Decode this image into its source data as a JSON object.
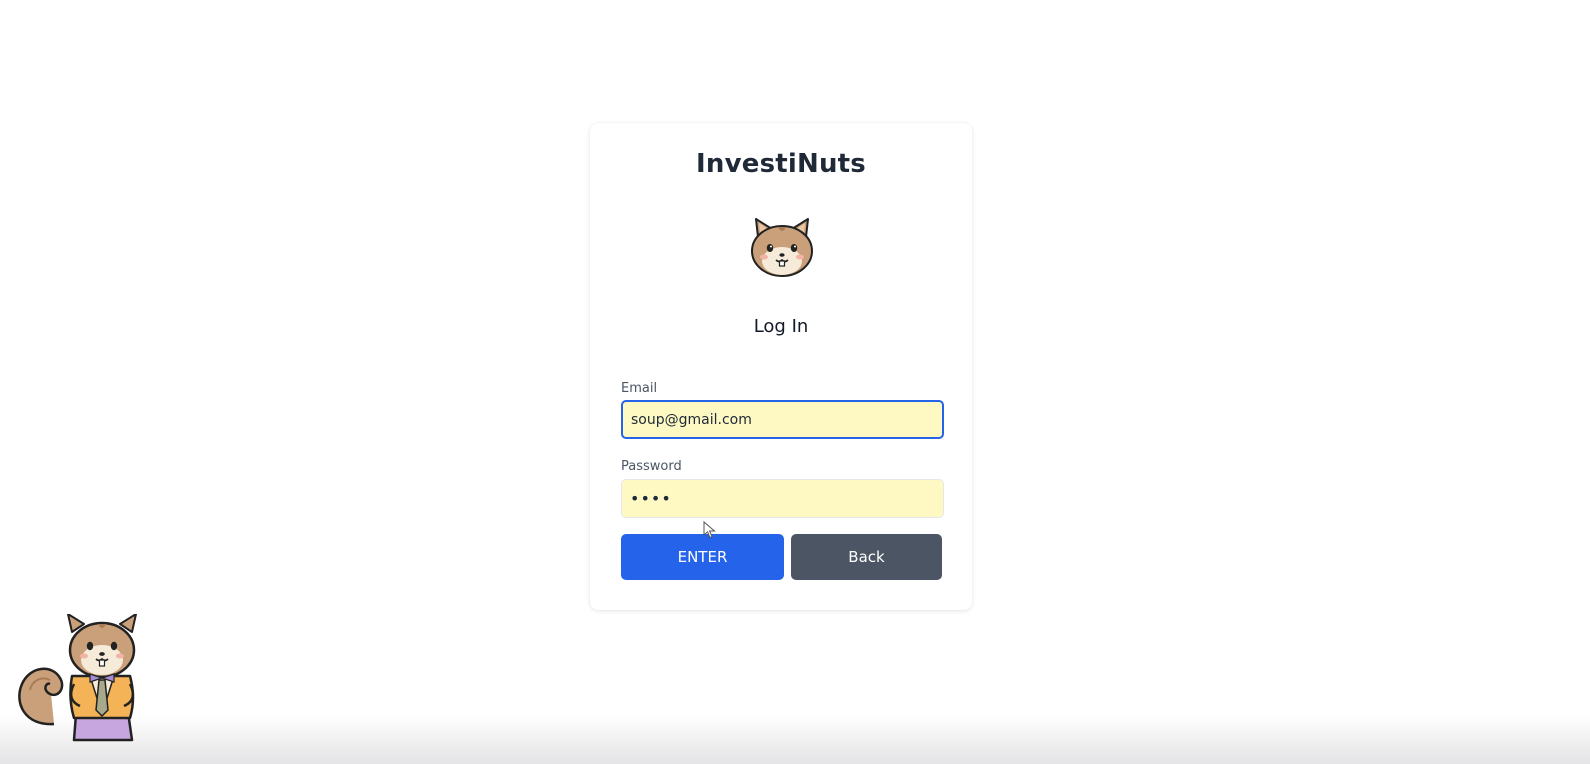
{
  "app": {
    "title": "InvestiNuts"
  },
  "login": {
    "heading": "Log In",
    "email_label": "Email",
    "email_value": "soup@gmail.com",
    "password_label": "Password",
    "password_value": "••••",
    "enter_button": "ENTER",
    "back_button": "Back"
  },
  "icons": {
    "logo": "squirrel-face-icon",
    "mascot": "squirrel-mascot-icon",
    "cursor": "mouse-pointer-icon"
  },
  "colors": {
    "primary": "#2563eb",
    "secondary": "#4b5563",
    "input_bg": "#fef9c3",
    "title": "#1f2937"
  }
}
